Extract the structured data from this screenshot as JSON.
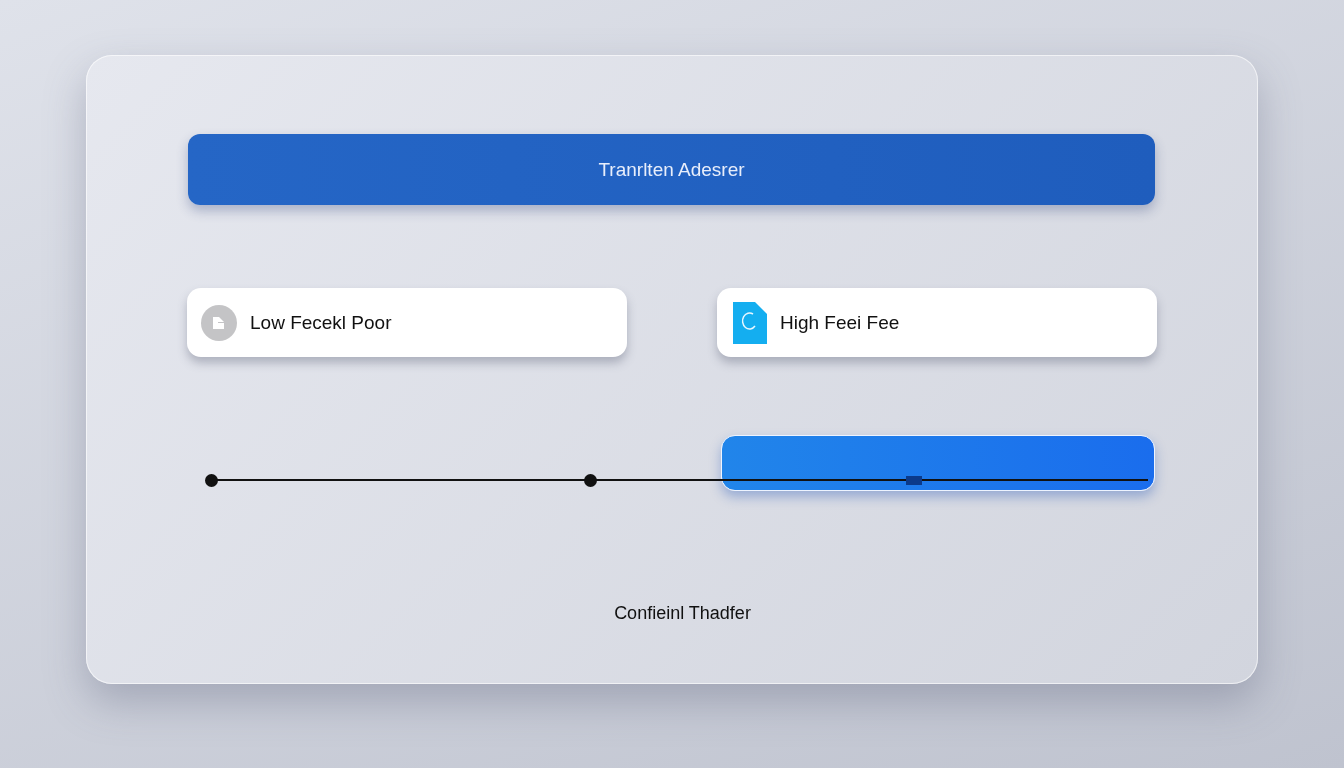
{
  "header": {
    "title": "Tranrlten Adesrer"
  },
  "options": [
    {
      "kind": "low",
      "label": "Low Fecekl Poor"
    },
    {
      "kind": "high",
      "label": "High Feei Fee"
    }
  ],
  "slider": {
    "level": 0.75
  },
  "footer": {
    "label": "Confieinl Thadfer"
  }
}
